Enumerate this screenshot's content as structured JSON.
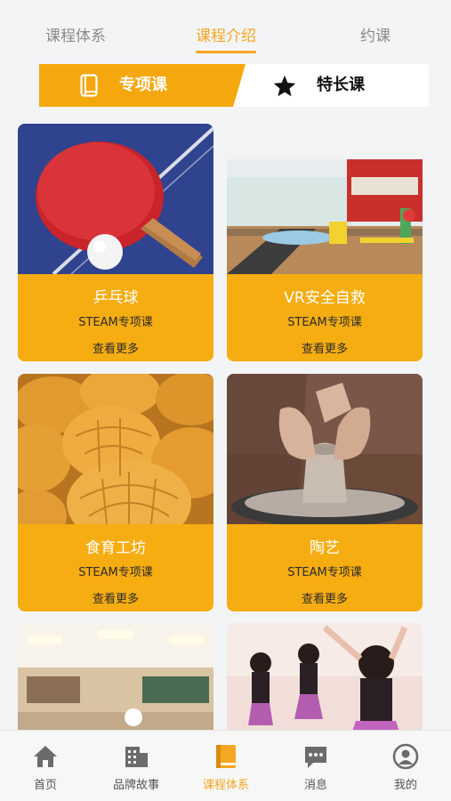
{
  "top_tabs": [
    {
      "label": "课程体系",
      "active": false
    },
    {
      "label": "课程介绍",
      "active": true
    },
    {
      "label": "约课",
      "active": false
    }
  ],
  "segment": {
    "left_label": "专项课",
    "left_icon": "book-icon",
    "right_label": "特长课",
    "right_icon": "star-icon",
    "active": "left"
  },
  "cards": [
    {
      "title": "乒乓球",
      "subtitle": "STEAM专项课",
      "more": "查看更多",
      "image": "ping-pong-paddle-image"
    },
    {
      "title": "VR安全自救",
      "subtitle": "STEAM专项课",
      "more": "查看更多",
      "image": "safety-classroom-image"
    },
    {
      "title": "食育工坊",
      "subtitle": "STEAM专项课",
      "more": "查看更多",
      "image": "pineapple-buns-image"
    },
    {
      "title": "陶艺",
      "subtitle": "STEAM专项课",
      "more": "查看更多",
      "image": "pottery-wheel-image"
    },
    {
      "title": "",
      "subtitle": "",
      "more": "",
      "image": "classroom-image"
    },
    {
      "title": "",
      "subtitle": "",
      "more": "",
      "image": "ballet-dancers-image"
    }
  ],
  "bottom_nav": [
    {
      "label": "首页",
      "icon": "home-icon",
      "active": false
    },
    {
      "label": "品牌故事",
      "icon": "building-icon",
      "active": false
    },
    {
      "label": "课程体系",
      "icon": "book-icon",
      "active": true
    },
    {
      "label": "消息",
      "icon": "chat-icon",
      "active": false
    },
    {
      "label": "我的",
      "icon": "user-icon",
      "active": false
    }
  ],
  "colors": {
    "accent": "#f5a623",
    "card_body": "#f6ad12",
    "inactive_text": "#8a8a8a"
  }
}
